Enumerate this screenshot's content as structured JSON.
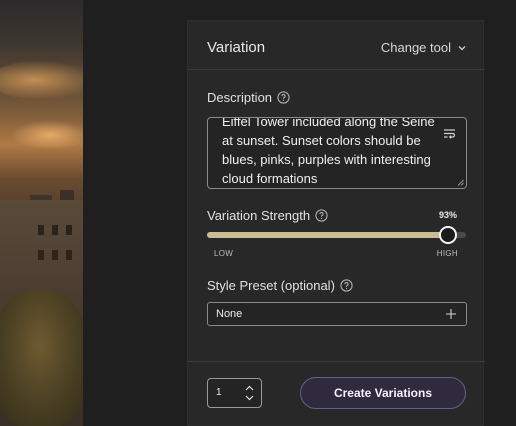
{
  "panel": {
    "title": "Variation",
    "change_tool_label": "Change tool"
  },
  "description": {
    "label": "Description",
    "text": "Eiffel Tower included along the Seine at sunset.  Sunset colors should be blues, pinks, purples with interesting cloud formations"
  },
  "variation_strength": {
    "label": "Variation Strength",
    "value_label": "93%",
    "value_fraction": 0.93,
    "low_label": "LOW",
    "high_label": "HIGH"
  },
  "style_preset": {
    "label": "Style Preset (optional)",
    "selected": "None"
  },
  "footer": {
    "count_value": "1",
    "create_label": "Create Variations"
  },
  "colors": {
    "slider_fill": "#c9bd95",
    "button_border": "#6a5d86",
    "panel_bg": "#282828"
  },
  "icons": [
    "chevron-down-icon",
    "help-icon",
    "text-wrap-icon",
    "resize-handle-icon",
    "plus-icon",
    "stepper-arrows-icon"
  ]
}
